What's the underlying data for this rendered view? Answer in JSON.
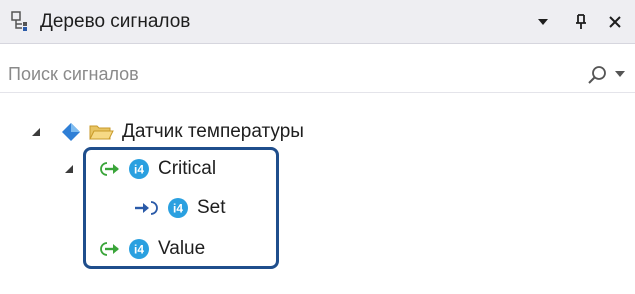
{
  "panel": {
    "title": "Дерево сигналов",
    "title_icon": "signal-tree-icon",
    "buttons": [
      {
        "name": "dropdown-menu",
        "icon": "triangle-down-icon"
      },
      {
        "name": "pin",
        "icon": "pin-icon"
      },
      {
        "name": "close",
        "icon": "close-icon"
      }
    ]
  },
  "search": {
    "placeholder": "Поиск сигналов",
    "value": "",
    "icon": "search-icon",
    "dropdown_icon": "chevron-down-icon"
  },
  "tree": {
    "root": {
      "label": "Датчик температуры",
      "expanded": true,
      "icons": [
        "blue-diamond-icon",
        "folder-icon"
      ]
    },
    "children": [
      {
        "label": "Critical",
        "expanded": true,
        "icons": [
          "output-arrow-icon",
          "i4-type-icon"
        ],
        "children": [
          {
            "label": "Set",
            "icons": [
              "input-arrow-icon",
              "i4-type-icon"
            ]
          }
        ]
      },
      {
        "label": "Value",
        "icons": [
          "output-arrow-icon",
          "i4-type-icon"
        ]
      }
    ],
    "type_badge_text": "i4"
  },
  "colors": {
    "titlebar_bg": "#eeeef2",
    "text": "#1e1e1e",
    "placeholder": "#8a8a8a",
    "highlight_border": "#1f4e8c",
    "type_badge": "#2aa0e0",
    "output_arrow": "#3aa53a",
    "input_arrow": "#2a5aa8",
    "folder": "#e8c462",
    "diamond": "#2f7fd6"
  }
}
